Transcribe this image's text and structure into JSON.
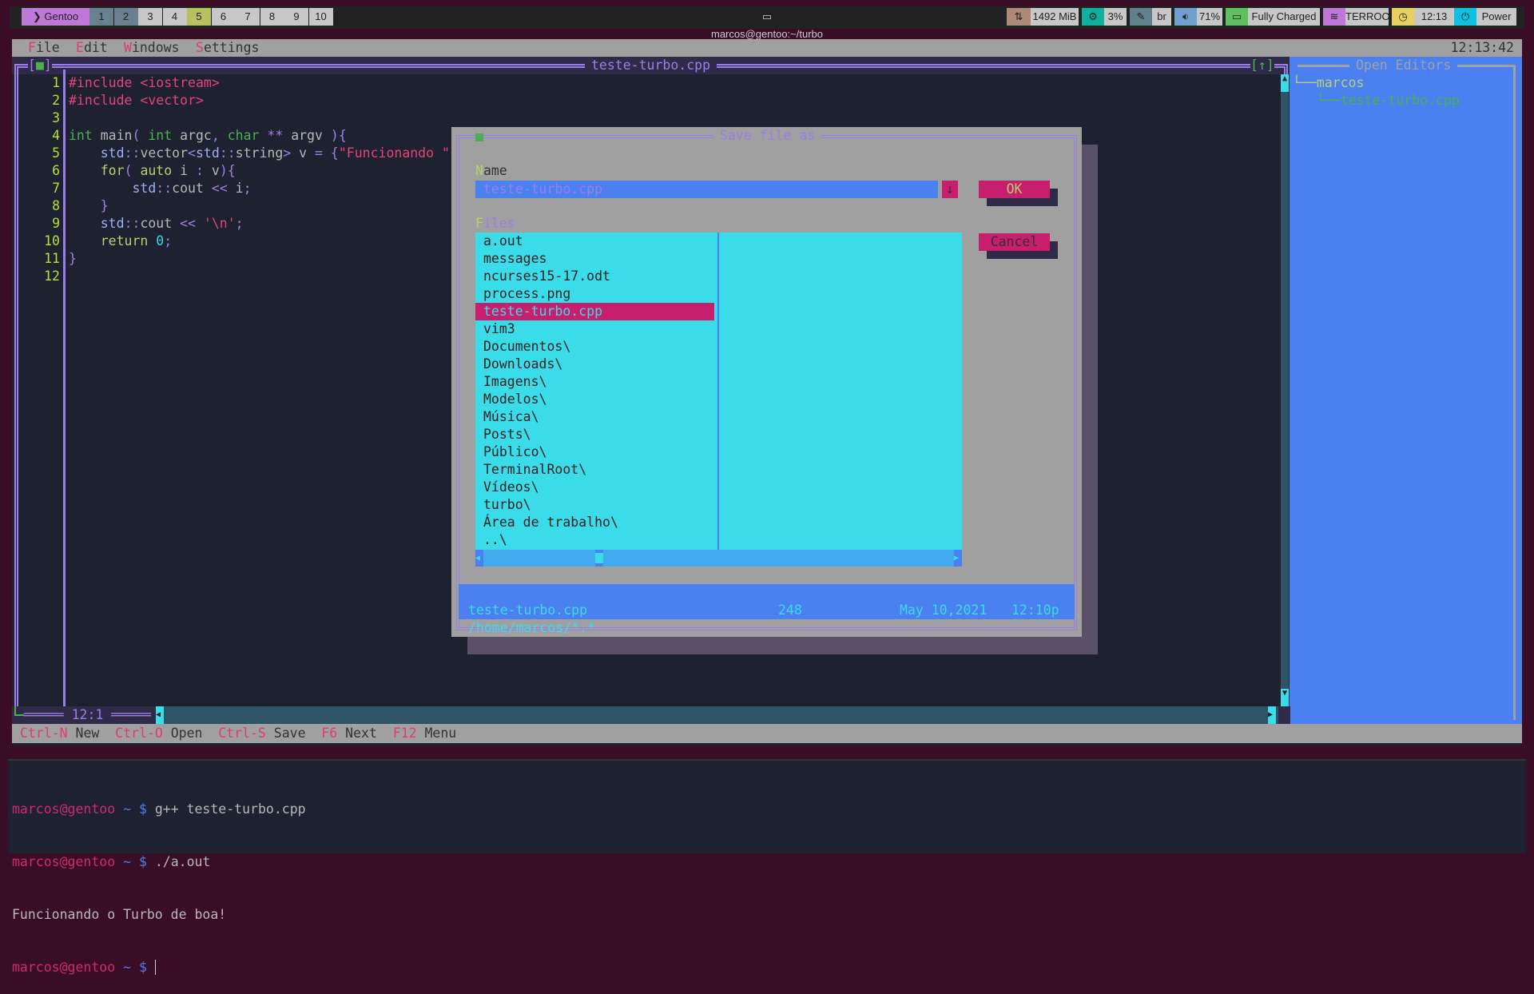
{
  "topbar": {
    "distro": "Gentoo",
    "workspaces": [
      "1",
      "2",
      "3",
      "4",
      "5",
      "6",
      "7",
      "8",
      "9",
      "10"
    ],
    "active_workspace": "5",
    "window_title": "marcos@gentoo:~/turbo",
    "memory": "1492 MiB",
    "cpu": "3%",
    "keyboard": "br",
    "volume": "71%",
    "battery": "Fully Charged",
    "wifi": "TERROO",
    "clock": "12:13",
    "power": "Power"
  },
  "menubar": {
    "items": [
      {
        "hk": "F",
        "rest": "ile"
      },
      {
        "hk": "E",
        "rest": "dit"
      },
      {
        "hk": "W",
        "rest": "indows"
      },
      {
        "hk": "S",
        "rest": "ettings"
      }
    ],
    "clock": "12:13:42"
  },
  "editor": {
    "title": "teste-turbo.cpp",
    "close_marker": "■",
    "zoom_marker": "[↑]",
    "line_numbers": [
      "1",
      "2",
      "3",
      "4",
      "5",
      "6",
      "7",
      "8",
      "9",
      "10",
      "11",
      "12"
    ],
    "cursor_pos": "12:1"
  },
  "open_editors": {
    "title": "Open Editors",
    "folder": "marcos",
    "file": "teste-turbo.cpp"
  },
  "shortcuts": [
    {
      "key": "Ctrl-N",
      "label": "New"
    },
    {
      "key": "Ctrl-O",
      "label": "Open"
    },
    {
      "key": "Ctrl-S",
      "label": "Save"
    },
    {
      "key": "F6",
      "label": "Next"
    },
    {
      "key": "F12",
      "label": "Menu"
    }
  ],
  "dialog": {
    "title": "Save file as",
    "name_label_hk": "N",
    "name_label_rest": "ame",
    "name_value": "teste-turbo.cpp",
    "files_label_hk": "F",
    "files_label_rest": "iles",
    "ok": "OK",
    "cancel": "Cancel",
    "files": [
      "a.out",
      "messages",
      "ncurses15-17.odt",
      "process.png",
      "teste-turbo.cpp",
      "vim3",
      "Documentos\\",
      "Downloads\\",
      "Imagens\\",
      "Modelos\\",
      "Música\\",
      "Posts\\",
      "Público\\",
      "TerminalRoot\\",
      "Vídeos\\",
      "turbo\\",
      "Área de trabalho\\",
      "..\\"
    ],
    "selected_file": "teste-turbo.cpp",
    "info_path": "/home/marcos/*.*",
    "info_name": "teste-turbo.cpp",
    "info_size": "248",
    "info_date": "May 10,2021",
    "info_time": "12:10p"
  },
  "terminal": {
    "prompt_user": "marcos@gentoo",
    "prompt_tilde": "~",
    "prompt_dollar": "$",
    "lines": [
      {
        "cmd": "g++ teste-turbo.cpp"
      },
      {
        "cmd": "./a.out"
      }
    ],
    "output": "Funcionando o Turbo de boa!"
  },
  "colors": {
    "accent": "#9b7fe8",
    "selection": "#c81e6e",
    "panel": "#4a80f0",
    "list": "#3adcea"
  }
}
